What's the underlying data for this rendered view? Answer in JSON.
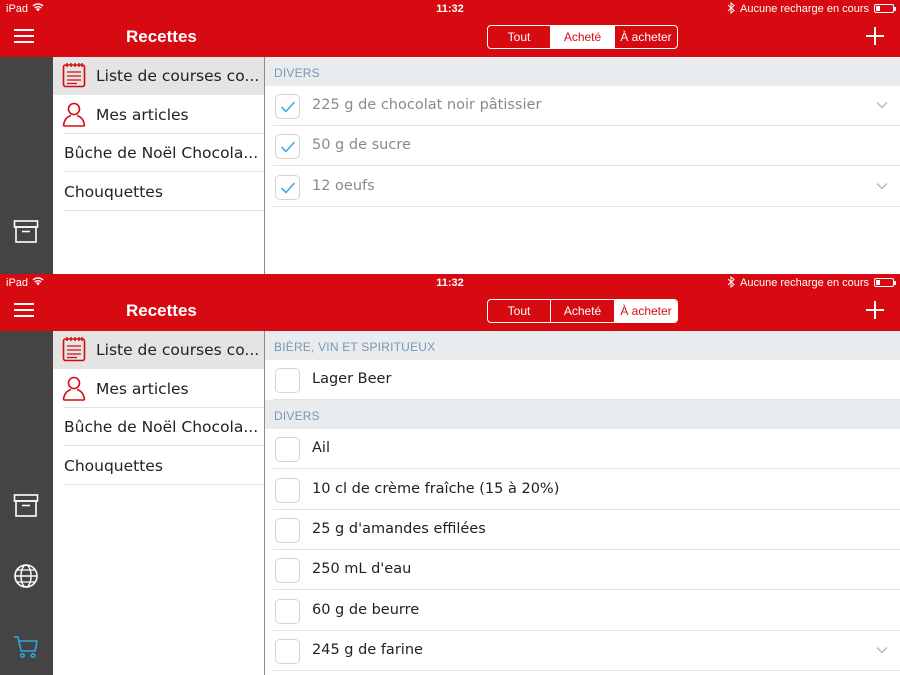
{
  "status": {
    "carrier": "iPad",
    "time": "11:32",
    "charging": "Aucune recharge en cours",
    "battery_level": 0.2
  },
  "header": {
    "title": "Recettes"
  },
  "segments": [
    "Tout",
    "Acheté",
    "À acheter"
  ],
  "sidebar": {
    "items": [
      {
        "label": "Liste de courses co...",
        "icon": "notepad-icon"
      },
      {
        "label": "Mes articles",
        "icon": "person-icon"
      },
      {
        "label": "Bûche de Noël Chocola..."
      },
      {
        "label": "Chouquettes"
      }
    ]
  },
  "screens": {
    "top": {
      "active_segment": "Acheté",
      "sections": [
        {
          "title": "DIVERS",
          "items": [
            {
              "text": "225 g de chocolat noir pâtissier",
              "checked": true,
              "chevron": true
            },
            {
              "text": "50 g de sucre",
              "checked": true,
              "chevron": false
            },
            {
              "text": "12 oeufs",
              "checked": true,
              "chevron": true
            }
          ]
        }
      ]
    },
    "bottom": {
      "active_segment": "À acheter",
      "sections": [
        {
          "title": "BIÈRE, VIN ET SPIRITUEUX",
          "items": [
            {
              "text": "Lager Beer",
              "checked": false,
              "chevron": false
            }
          ]
        },
        {
          "title": "DIVERS",
          "items": [
            {
              "text": "Ail",
              "checked": false,
              "chevron": false
            },
            {
              "text": "10 cl de crème fraîche (15 à 20%)",
              "checked": false,
              "chevron": false
            },
            {
              "text": "25 g d'amandes effilées",
              "checked": false,
              "chevron": false
            },
            {
              "text": "250 mL d'eau",
              "checked": false,
              "chevron": false
            },
            {
              "text": "60 g de beurre",
              "checked": false,
              "chevron": false
            },
            {
              "text": "245 g de farine",
              "checked": false,
              "chevron": true
            }
          ]
        }
      ]
    }
  },
  "colors": {
    "brand_red": "#d70a12",
    "side_bar": "#444444",
    "section_bg": "#e9ecef",
    "section_text": "#7b96ad",
    "check_blue": "#3aaee0",
    "cart_blue": "#2fa6e0"
  }
}
